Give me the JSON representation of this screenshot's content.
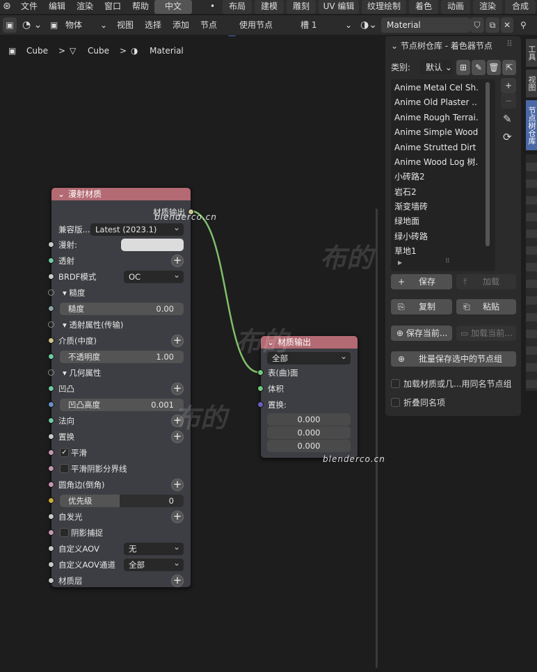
{
  "menu": {
    "items": [
      "文件",
      "编辑",
      "渲染",
      "窗口",
      "帮助",
      "中文"
    ],
    "workspaces": [
      "布局",
      "建模",
      "雕刻",
      "UV 编辑",
      "纹理绘制",
      "着色",
      "动画",
      "渲染",
      "合成"
    ],
    "dot": "•"
  },
  "header": {
    "object_mode": "物体",
    "menus": [
      "视图",
      "选择",
      "添加",
      "节点"
    ],
    "use_nodes_label": "使用节点",
    "slot": "槽 1",
    "material_name": "Material"
  },
  "breadcrumb": {
    "items": [
      "Cube",
      "Cube",
      "Material"
    ],
    "sep": ">"
  },
  "principled": {
    "title": "漫射材质",
    "output_label": "材质输出",
    "compat_label": "兼容版...",
    "compat_value": "Latest (2023.1)",
    "diffuse": "漫射:",
    "transmission": "透射",
    "brdf_label": "BRDF模式",
    "brdf_value": "OC",
    "roughness_section": "糙度",
    "roughness_label": "糙度",
    "roughness_value": "0.00",
    "transm_props": "透射属性(传输)",
    "medium": "介质(中度)",
    "opacity_label": "不透明度",
    "opacity_value": "1.00",
    "geometry": "几何属性",
    "bump": "凹凸",
    "bump_height_label": "凹凸高度",
    "bump_height_value": "0.001",
    "normal": "法向",
    "displacement": "置换",
    "smooth": "平滑",
    "smooth_shadow": "平滑阴影分界线",
    "round_edges": "圆角边(倒角)",
    "priority_label": "优先级",
    "priority_value": "0",
    "emission": "自发光",
    "shadow_catcher": "阴影捕捉",
    "custom_aov": "自定义AOV",
    "custom_aov_value": "无",
    "custom_aov_channel": "自定义AOV通道",
    "custom_aov_channel_value": "全部",
    "material_layer": "材质层"
  },
  "output_node": {
    "title": "材质输出",
    "target": "全部",
    "surface": "表(曲)面",
    "volume": "体积",
    "displacement": "置换:",
    "values": [
      "0.000",
      "0.000",
      "0.000"
    ]
  },
  "panel": {
    "title": "节点树仓库 - 着色器节点",
    "category_label": "类别:",
    "category_value": "默认",
    "items": [
      "Anime Metal Cel Sh...",
      "Anime Old Plaster ...",
      "Anime Rough Terrai...",
      "Anime Simple Wood ...",
      "Anime Strutted Dirt ...",
      "Anime Wood Log 树...",
      "小砖路2",
      "岩石2",
      "渐变墙砖",
      "绿地面",
      "绿小砖路",
      "草地1"
    ],
    "save": "保存",
    "load": "加载",
    "copy": "复制",
    "paste": "粘贴",
    "save_current": "保存当前...",
    "load_current": "加载当前...",
    "batch_save": "批量保存选中的节点组",
    "load_material": "加载材质或几...用同名节点组",
    "fold_same": "折叠同名项"
  },
  "vtabs": [
    "工具",
    "视图",
    "节点树仓库"
  ],
  "watermarks": {
    "site": "blenderco.cn",
    "brand": "布的"
  },
  "colors": {
    "node_header": "#b36a73",
    "wire": "#7fbf6a",
    "active_tab": "#4b69a7"
  }
}
